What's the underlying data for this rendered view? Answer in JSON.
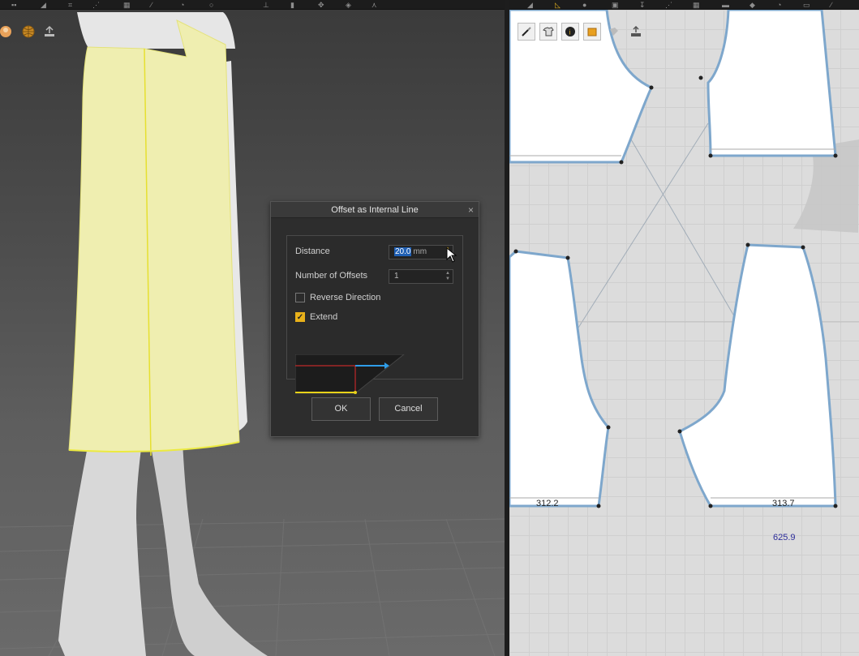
{
  "dialog": {
    "title": "Offset as Internal Line",
    "close_glyph": "×",
    "distance_label": "Distance",
    "distance_value": "20.0",
    "distance_unit": "mm",
    "offsets_label": "Number of Offsets",
    "offsets_value": "1",
    "reverse_label": "Reverse Direction",
    "reverse_checked": false,
    "extend_label": "Extend",
    "extend_checked": true,
    "ok_label": "OK",
    "cancel_label": "Cancel"
  },
  "pattern": {
    "measure_left": "312.2",
    "measure_right": "313.7",
    "measure_total": "625.9"
  },
  "colors": {
    "garment": "#efeeb0",
    "pattern_outline": "#7ea7cc",
    "selection_blue": "#1f5fb4",
    "check_accent": "#e8b11a"
  },
  "icons": {
    "viewport_tools": [
      "avatar-icon",
      "globe-icon",
      "export-icon"
    ],
    "pattern_tools": [
      "brush-icon",
      "shirt-icon",
      "info-icon",
      "fabric-icon",
      "fold-icon",
      "export-icon"
    ]
  }
}
